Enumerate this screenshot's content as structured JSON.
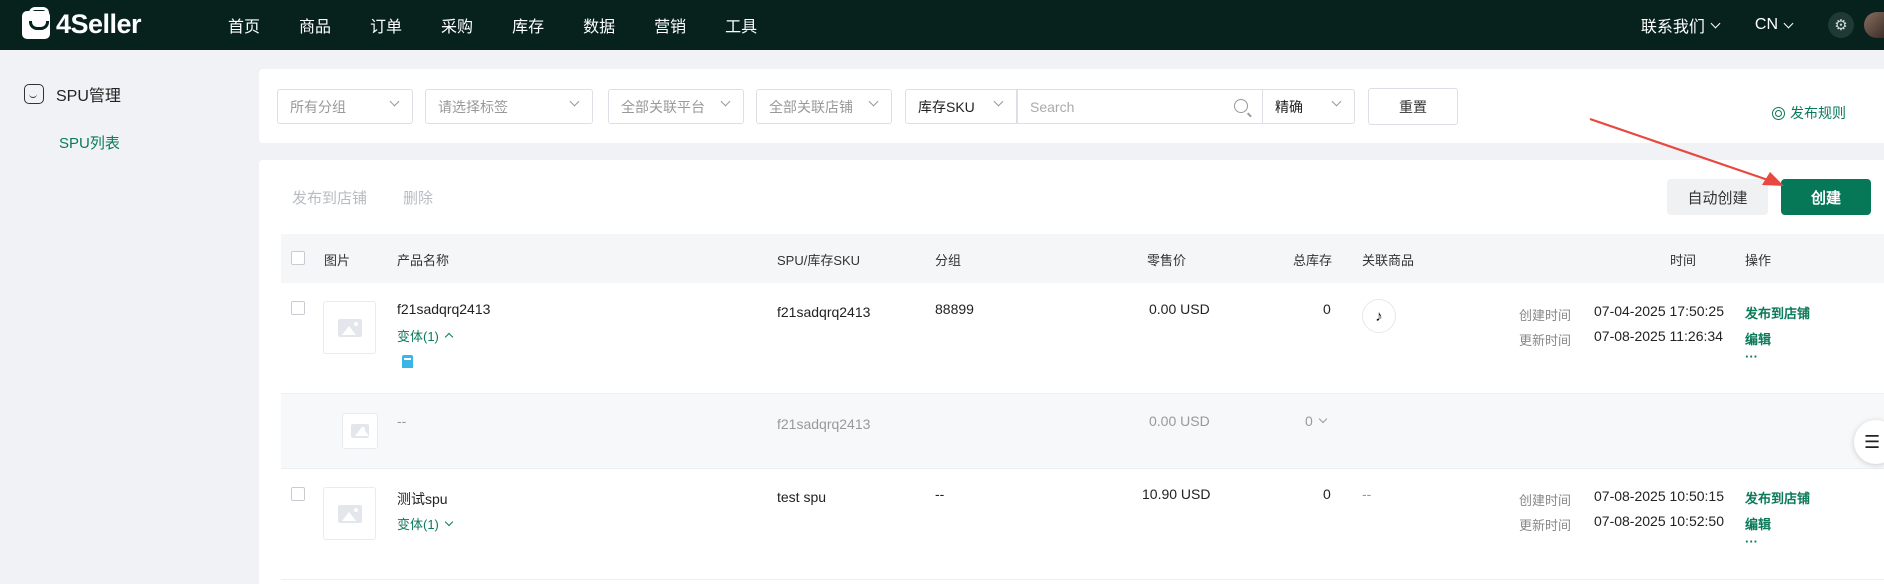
{
  "app": {
    "logo_text": "4Seller",
    "nav": [
      "首页",
      "商品",
      "订单",
      "采购",
      "库存",
      "数据",
      "营销",
      "工具"
    ],
    "contact_label": "联系我们",
    "lang_label": "CN"
  },
  "sidebar": {
    "group_label": "SPU管理",
    "items": [
      {
        "label": "SPU列表",
        "active": true
      }
    ]
  },
  "filters": {
    "group_placeholder": "所有分组",
    "tag_placeholder": "请选择标签",
    "platform_placeholder": "全部关联平台",
    "store_placeholder": "全部关联店铺",
    "search_field": "库存SKU",
    "search_placeholder": "Search",
    "match_mode": "精确",
    "reset_label": "重置",
    "publish_rules_label": "发布规则"
  },
  "toolbar": {
    "publish_label": "发布到店铺",
    "delete_label": "删除",
    "auto_create_label": "自动创建",
    "create_label": "创建"
  },
  "table": {
    "headers": {
      "image": "图片",
      "name": "产品名称",
      "sku": "SPU/库存SKU",
      "group": "分组",
      "price": "零售价",
      "stock": "总库存",
      "linked": "关联商品",
      "time": "时间",
      "ops": "操作"
    },
    "rows": [
      {
        "name": "f21sadqrq2413",
        "variant_label": "变体(1)",
        "sku": "f21sadqrq2413",
        "group": "88899",
        "price": "0.00 USD",
        "stock": "0",
        "linked_platform": "tiktok-icon",
        "created_label": "创建时间",
        "created": "07-04-2025 17:50:25",
        "updated_label": "更新时间",
        "updated": "07-08-2025 11:26:34",
        "action_publish": "发布到店铺",
        "action_edit": "编辑",
        "action_more": "···"
      },
      {
        "is_variant": true,
        "name": "--",
        "sku": "f21sadqrq2413",
        "price": "0.00 USD",
        "stock": "0"
      },
      {
        "name": "测试spu",
        "variant_label": "变体(1)",
        "sku": "test spu",
        "group": "--",
        "price": "10.90 USD",
        "stock": "0",
        "linked": "--",
        "created_label": "创建时间",
        "created": "07-08-2025 10:50:15",
        "updated_label": "更新时间",
        "updated": "07-08-2025 10:52:50",
        "action_publish": "发布到店铺",
        "action_edit": "编辑",
        "action_more": "···"
      }
    ]
  },
  "colors": {
    "topbar": "#07221c",
    "brand_green": "#067857",
    "link_green": "#0a7a5a",
    "annotation_arrow": "#e8483f"
  }
}
